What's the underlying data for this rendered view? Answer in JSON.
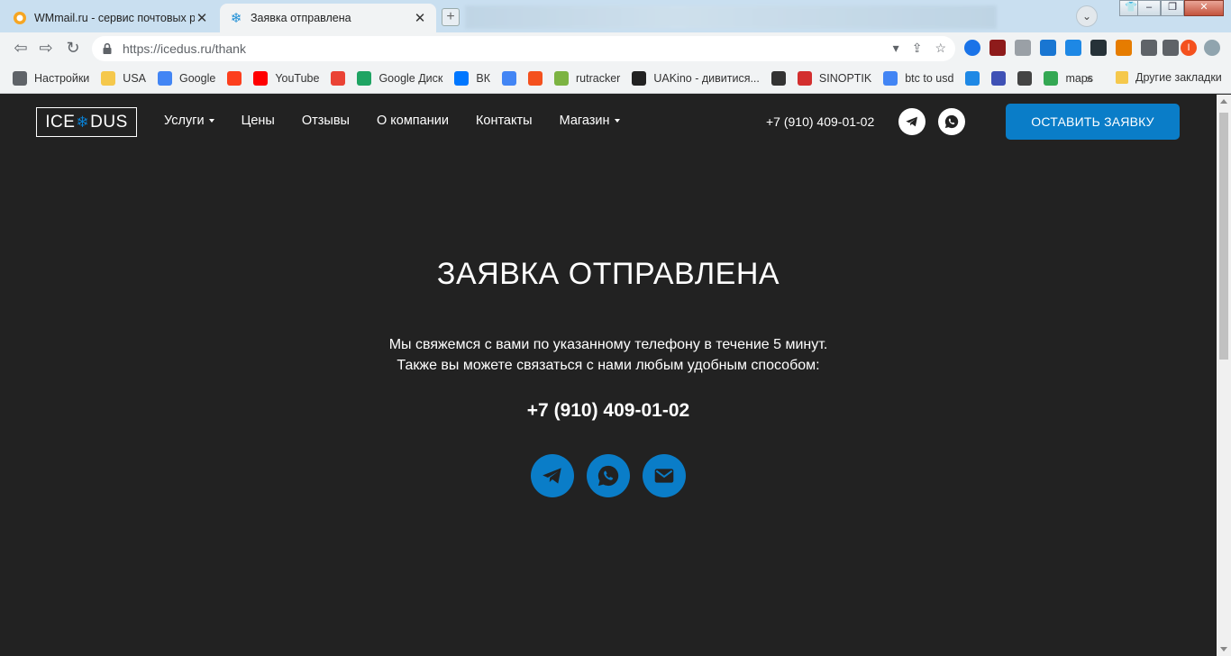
{
  "browser": {
    "tabs": [
      {
        "title": "WMmail.ru - сервис почтовых рас",
        "active": false
      },
      {
        "title": "Заявка отправлена",
        "active": true
      }
    ],
    "new_tab": "+",
    "url": "https://icedus.ru/thank",
    "profile_initial": "I"
  },
  "bookmarks": {
    "items": [
      {
        "label": "Настройки",
        "icon": "gear-icon",
        "color": "#5f6368"
      },
      {
        "label": "USA",
        "icon": "folder-icon",
        "color": "#f5c84c"
      },
      {
        "label": "Google",
        "icon": "google-icon",
        "color": "#4285f4"
      },
      {
        "label": "",
        "icon": "yandex-icon",
        "color": "#fc3f1d"
      },
      {
        "label": "YouTube",
        "icon": "youtube-icon",
        "color": "#ff0000"
      },
      {
        "label": "",
        "icon": "gmail-icon",
        "color": "#ea4335"
      },
      {
        "label": "Google Диск",
        "icon": "google-drive-icon",
        "color": "#1fa463"
      },
      {
        "label": "ВК",
        "icon": "vk-icon",
        "color": "#0077ff"
      },
      {
        "label": "",
        "icon": "google-translate-icon",
        "color": "#4285f4"
      },
      {
        "label": "",
        "icon": "f-icon",
        "color": "#f4511e"
      },
      {
        "label": "rutracker",
        "icon": "rutracker-icon",
        "color": "#7cb342"
      },
      {
        "label": "UAKino - дивитися...",
        "icon": "uakino-icon",
        "color": "#222222"
      },
      {
        "label": "",
        "icon": "chess-icon",
        "color": "#333333"
      },
      {
        "label": "SINOPTIK",
        "icon": "thermometer-icon",
        "color": "#d32f2f"
      },
      {
        "label": "btc to usd",
        "icon": "google-icon",
        "color": "#4285f4"
      },
      {
        "label": "",
        "icon": "p-icon",
        "color": "#1e88e5"
      },
      {
        "label": "",
        "icon": "chevron-icon",
        "color": "#3f51b5"
      },
      {
        "label": "",
        "icon": "bc-icon",
        "color": "#444444"
      },
      {
        "label": "maps",
        "icon": "maps-icon",
        "color": "#34a853"
      }
    ],
    "more": "»",
    "other": "Другие закладки"
  },
  "site": {
    "logo": {
      "left": "ICE",
      "snow": "❄",
      "right": "DUS"
    },
    "nav": [
      {
        "label": "Услуги",
        "dropdown": true
      },
      {
        "label": "Цены",
        "dropdown": false
      },
      {
        "label": "Отзывы",
        "dropdown": false
      },
      {
        "label": "О компании",
        "dropdown": false
      },
      {
        "label": "Контакты",
        "dropdown": false
      },
      {
        "label": "Магазин",
        "dropdown": true
      }
    ],
    "phone": "+7 (910) 409-01-02",
    "cta": "ОСТАВИТЬ ЗАЯВКУ",
    "accent": "#0a7dc8",
    "background": "#222222"
  },
  "main": {
    "title": "ЗАЯВКА ОТПРАВЛЕНА",
    "line1": "Мы свяжемся с вами по указанному телефону в течение 5 минут.",
    "line2": "Также вы можете связаться с нами любым удобным способом:",
    "phone": "+7 (910) 409-01-02",
    "contacts": [
      {
        "icon": "telegram-icon"
      },
      {
        "icon": "whatsapp-icon"
      },
      {
        "icon": "email-icon"
      }
    ]
  }
}
